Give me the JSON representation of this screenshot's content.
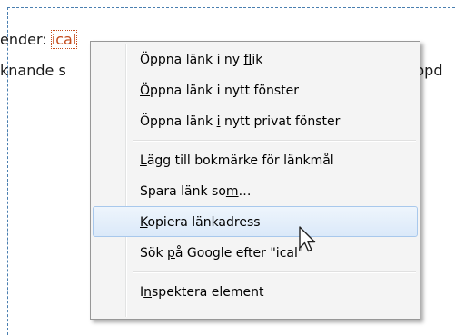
{
  "background": {
    "line1_prefix": "ender: ",
    "line1_link": "ical",
    "line2_start": "knande s",
    "line2_end": "ppd"
  },
  "menu": {
    "items": [
      {
        "pre": "Öppna länk i ny ",
        "key": "f",
        "post": "lik"
      },
      {
        "pre": "",
        "key": "Ö",
        "post": "ppna länk i nytt fönster"
      },
      {
        "pre": "Öppna länk ",
        "key": "i",
        "post": " nytt privat fönster"
      },
      {
        "pre": "",
        "key": "L",
        "post": "ägg till bokmärke för länkmål"
      },
      {
        "pre": "Spara länk so",
        "key": "m",
        "post": "…"
      },
      {
        "pre": "",
        "key": "K",
        "post": "opiera länkadress"
      },
      {
        "pre": "Sök ",
        "key": "p",
        "post": "å Google efter \"ical\""
      },
      {
        "pre": "I",
        "key": "n",
        "post": "spektera element"
      }
    ],
    "hovered_index": 5
  },
  "colors": {
    "link": "#c44a1a",
    "frame": "#4a7fb0",
    "hover_border": "#a8c8ec"
  },
  "icons": {
    "cursor": "arrow-pointer-icon"
  }
}
